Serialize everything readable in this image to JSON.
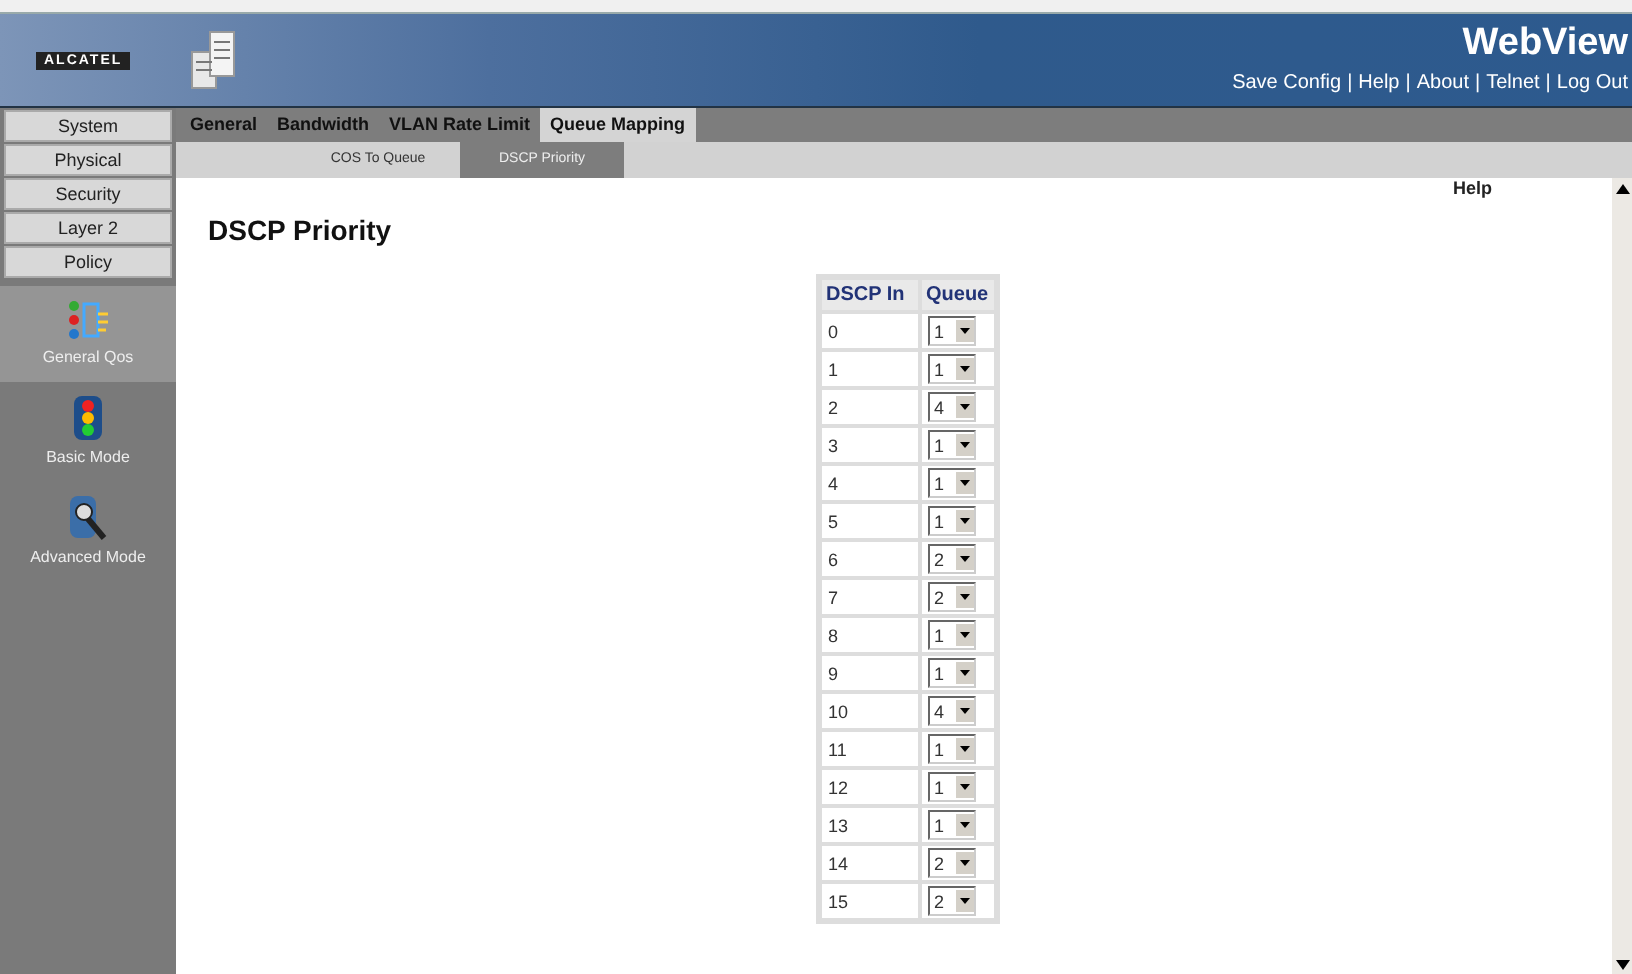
{
  "header": {
    "logo": "ALCATEL",
    "title": "WebView",
    "links": [
      "Save Config",
      "Help",
      "About",
      "Telnet",
      "Log Out"
    ],
    "separator": "|"
  },
  "menu": [
    {
      "label": "System"
    },
    {
      "label": "Physical"
    },
    {
      "label": "Security"
    },
    {
      "label": "Layer 2"
    },
    {
      "label": "Policy"
    }
  ],
  "modes": [
    {
      "label": "General Qos",
      "kind": "general",
      "selected": true
    },
    {
      "label": "Basic Mode",
      "kind": "basic",
      "selected": false
    },
    {
      "label": "Advanced Mode",
      "kind": "advanced",
      "selected": false
    }
  ],
  "tabs": [
    {
      "label": "General",
      "selected": false
    },
    {
      "label": "Bandwidth",
      "selected": false
    },
    {
      "label": "VLAN Rate Limit",
      "selected": false
    },
    {
      "label": "Queue Mapping",
      "selected": true
    }
  ],
  "subtabs": [
    {
      "label": "COS To Queue",
      "selected": false
    },
    {
      "label": "DSCP Priority",
      "selected": true
    }
  ],
  "help": "Help",
  "page_title": "DSCP Priority",
  "table": {
    "columns": [
      "DSCP In",
      "Queue"
    ],
    "rows": [
      {
        "dscp": "0",
        "queue": "1"
      },
      {
        "dscp": "1",
        "queue": "1"
      },
      {
        "dscp": "2",
        "queue": "4"
      },
      {
        "dscp": "3",
        "queue": "1"
      },
      {
        "dscp": "4",
        "queue": "1"
      },
      {
        "dscp": "5",
        "queue": "1"
      },
      {
        "dscp": "6",
        "queue": "2"
      },
      {
        "dscp": "7",
        "queue": "2"
      },
      {
        "dscp": "8",
        "queue": "1"
      },
      {
        "dscp": "9",
        "queue": "1"
      },
      {
        "dscp": "10",
        "queue": "4"
      },
      {
        "dscp": "11",
        "queue": "1"
      },
      {
        "dscp": "12",
        "queue": "1"
      },
      {
        "dscp": "13",
        "queue": "1"
      },
      {
        "dscp": "14",
        "queue": "2"
      },
      {
        "dscp": "15",
        "queue": "2"
      }
    ]
  }
}
